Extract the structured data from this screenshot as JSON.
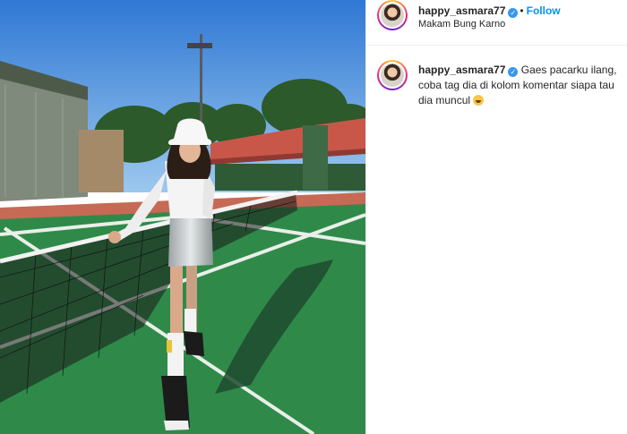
{
  "post": {
    "username": "happy_asmara77",
    "verified": true,
    "follow_label": "Follow",
    "separator": "•",
    "location": "Makam Bung Karno",
    "caption": "Gaes pacarku ilang, coba tag dia di kolom komentar siapa tau dia muncul",
    "caption_emoji": "loudly-crying-face-icon"
  },
  "colors": {
    "follow_blue": "#0095f6",
    "verified_blue": "#3897f0",
    "court_green": "#2f8a4a",
    "court_red": "#c8574a",
    "sky": "#3a86d8"
  }
}
